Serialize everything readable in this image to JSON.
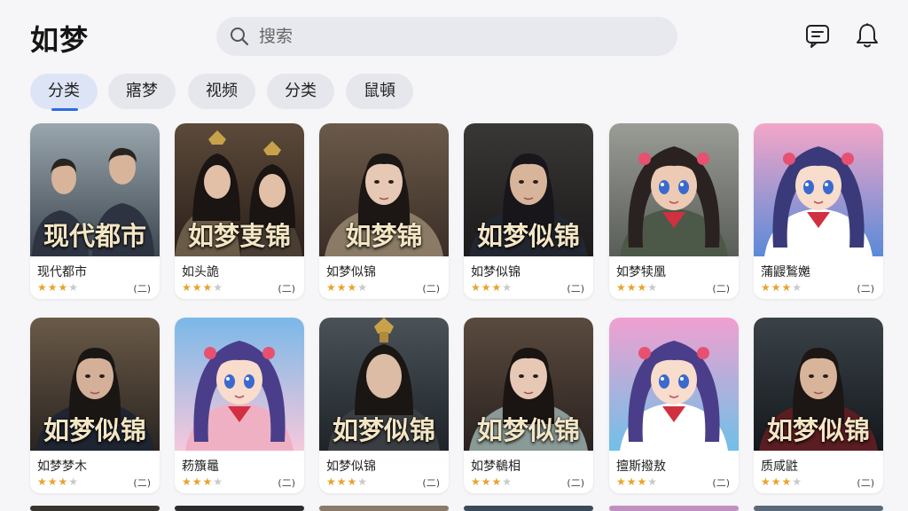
{
  "header": {
    "logo": "如梦",
    "search_placeholder": "搜索",
    "icons": [
      "search-icon",
      "message-icon",
      "bell-icon"
    ]
  },
  "tabs": [
    {
      "label": "分类",
      "active": true
    },
    {
      "label": "寤梦",
      "active": false
    },
    {
      "label": "视频",
      "active": false
    },
    {
      "label": "分类",
      "active": false
    },
    {
      "label": "鼠頓",
      "active": false
    }
  ],
  "colors": {
    "accent": "#2e6ae6",
    "star": "#e8a22d",
    "background": "#f6f6f8"
  },
  "rows": [
    [
      {
        "overlay": "现代都市",
        "name": "现代都市",
        "rating": 3,
        "count": "(二)"
      },
      {
        "overlay": "如梦叓锦",
        "name": "如头詭",
        "rating": 3,
        "count": "(二)"
      },
      {
        "overlay": "如梦锦",
        "name": "如梦似锦",
        "rating": 3,
        "count": "(二)"
      },
      {
        "overlay": "如梦似锦",
        "name": "如梦似锦",
        "rating": 3,
        "count": "(二)"
      },
      {
        "overlay": "",
        "name": "如梦犊凰",
        "rating": 3,
        "count": "(二)"
      },
      {
        "overlay": "",
        "name": "蒲鼹鶖嬔",
        "rating": 3,
        "count": "(二)"
      }
    ],
    [
      {
        "overlay": "如梦似锦",
        "name": "如梦梦木",
        "rating": 3,
        "count": "(二)"
      },
      {
        "overlay": "",
        "name": "菞籏鼂",
        "rating": 3,
        "count": "(二)"
      },
      {
        "overlay": "如梦似锦",
        "name": "如梦似锦",
        "rating": 3,
        "count": "(二)"
      },
      {
        "overlay": "如梦似锦",
        "name": "如梦鵗相",
        "rating": 3,
        "count": "(二)"
      },
      {
        "overlay": "",
        "name": "擅斯撥敖",
        "rating": 3,
        "count": "(二)"
      },
      {
        "overlay": "如梦似锦",
        "name": "质咸鼪",
        "rating": 3,
        "count": "(二)"
      }
    ]
  ]
}
